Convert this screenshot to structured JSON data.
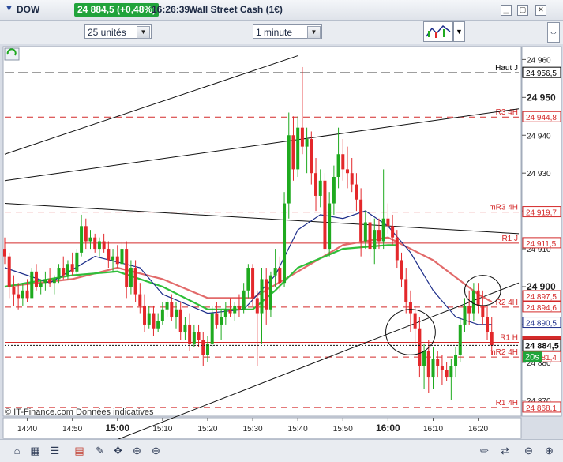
{
  "header": {
    "instrument": "DOW",
    "price_change": "24 884,5 (+0,48%)",
    "time": "16:26:39",
    "title": "Wall Street Cash (1€)",
    "dropdown_icon": "chevron-down-icon",
    "window_icons": [
      "minimize-icon",
      "maximize-icon",
      "close-icon"
    ]
  },
  "toolbar": {
    "units_select": "25 unités",
    "interval_select": "1 minute",
    "chart_tool_icon": "indicator-chart-icon"
  },
  "colors": {
    "bull": "#1faa1f",
    "bear": "#e3282b",
    "ma_slow": "#e26a6a",
    "ma_mid": "#2fbf3a",
    "ma_fast": "#1d2e8a",
    "price_tag": "#1fa53a"
  },
  "chart_data": {
    "type": "candlestick",
    "ylim": [
      24866,
      24963
    ],
    "yticks": [
      24870,
      24880,
      24890,
      24900,
      24910,
      24920,
      24930,
      24940,
      24950,
      24960
    ],
    "ytick_labels": [
      "24 870",
      "24 880",
      "24 890",
      "24 900",
      "24 910",
      "24 920",
      "24 930",
      "24 940",
      "24 950",
      "24 960"
    ],
    "major_yticks": [
      24950,
      24900
    ],
    "x_start": "14:35",
    "x_end": "16:29",
    "xticks": [
      "14:40",
      "14:50",
      "15:00",
      "15:10",
      "15:20",
      "15:30",
      "15:40",
      "15:50",
      "16:00",
      "16:10",
      "16:20"
    ],
    "major_xticks": [
      "15:00",
      "16:00"
    ],
    "levels": [
      {
        "name": "Haut J",
        "value": 24956.5,
        "label": "24 956,5",
        "style": "longdash",
        "color": "#000000"
      },
      {
        "name": "R3 4H",
        "value": 24944.8,
        "label": "24 944,8",
        "style": "dash",
        "color": "#d42a2a"
      },
      {
        "name": "mR3 4H",
        "value": 24919.7,
        "label": "24 919,7",
        "style": "dash",
        "color": "#d42a2a"
      },
      {
        "name": "R1 J",
        "value": 24911.5,
        "label": "24 911,5",
        "style": "solid",
        "color": "#d42a2a"
      },
      {
        "name": "",
        "value": 24897.5,
        "label": "24 897,5",
        "style": "none",
        "color": "#d42a2a"
      },
      {
        "name": "R2 4H",
        "value": 24894.6,
        "label": "24 894,6",
        "style": "dash",
        "color": "#d42a2a"
      },
      {
        "name": "",
        "value": 24890.5,
        "label": "24 890,5",
        "style": "none",
        "color": "#1d2e8a"
      },
      {
        "name": "R1 H",
        "value": 24885.3,
        "label": "24 885,3",
        "style": "solid",
        "color": "#d42a2a"
      },
      {
        "name": "mR2 4H",
        "value": 24881.4,
        "label": "24 881,4",
        "style": "dash",
        "color": "#d42a2a"
      },
      {
        "name": "R1 4H",
        "value": 24868.1,
        "label": "24 868,1",
        "style": "dash",
        "color": "#d42a2a"
      }
    ],
    "current_price": {
      "value": 24884.5,
      "label": "24 884,5",
      "countdown": "20s"
    },
    "candles": [
      {
        "t": "14:35",
        "o": 24910,
        "h": 24913,
        "l": 24906,
        "c": 24908
      },
      {
        "t": "14:36",
        "o": 24908,
        "h": 24909,
        "l": 24897,
        "c": 24900
      },
      {
        "t": "14:37",
        "o": 24900,
        "h": 24903,
        "l": 24895,
        "c": 24898
      },
      {
        "t": "14:38",
        "o": 24898,
        "h": 24901,
        "l": 24894,
        "c": 24897
      },
      {
        "t": "14:39",
        "o": 24897,
        "h": 24901,
        "l": 24895,
        "c": 24899
      },
      {
        "t": "14:40",
        "o": 24899,
        "h": 24902,
        "l": 24896,
        "c": 24897
      },
      {
        "t": "14:41",
        "o": 24897,
        "h": 24905,
        "l": 24897,
        "c": 24904
      },
      {
        "t": "14:42",
        "o": 24904,
        "h": 24906,
        "l": 24899,
        "c": 24900
      },
      {
        "t": "14:43",
        "o": 24900,
        "h": 24902,
        "l": 24898,
        "c": 24901
      },
      {
        "t": "14:44",
        "o": 24901,
        "h": 24904,
        "l": 24899,
        "c": 24902
      },
      {
        "t": "14:45",
        "o": 24902,
        "h": 24905,
        "l": 24900,
        "c": 24901
      },
      {
        "t": "14:46",
        "o": 24901,
        "h": 24903,
        "l": 24898,
        "c": 24902
      },
      {
        "t": "14:47",
        "o": 24902,
        "h": 24906,
        "l": 24901,
        "c": 24905
      },
      {
        "t": "14:48",
        "o": 24905,
        "h": 24908,
        "l": 24902,
        "c": 24903
      },
      {
        "t": "14:49",
        "o": 24903,
        "h": 24907,
        "l": 24902,
        "c": 24906
      },
      {
        "t": "14:50",
        "o": 24906,
        "h": 24909,
        "l": 24903,
        "c": 24904
      },
      {
        "t": "14:51",
        "o": 24904,
        "h": 24910,
        "l": 24903,
        "c": 24909
      },
      {
        "t": "14:52",
        "o": 24909,
        "h": 24919,
        "l": 24908,
        "c": 24916
      },
      {
        "t": "14:53",
        "o": 24916,
        "h": 24918,
        "l": 24910,
        "c": 24912
      },
      {
        "t": "14:54",
        "o": 24912,
        "h": 24915,
        "l": 24910,
        "c": 24913
      },
      {
        "t": "14:55",
        "o": 24913,
        "h": 24914,
        "l": 24909,
        "c": 24910
      },
      {
        "t": "14:56",
        "o": 24910,
        "h": 24913,
        "l": 24908,
        "c": 24912
      },
      {
        "t": "14:57",
        "o": 24912,
        "h": 24914,
        "l": 24909,
        "c": 24910
      },
      {
        "t": "14:58",
        "o": 24910,
        "h": 24912,
        "l": 24905,
        "c": 24907
      },
      {
        "t": "14:59",
        "o": 24907,
        "h": 24910,
        "l": 24904,
        "c": 24908
      },
      {
        "t": "15:00",
        "o": 24908,
        "h": 24911,
        "l": 24905,
        "c": 24906
      },
      {
        "t": "15:01",
        "o": 24906,
        "h": 24912,
        "l": 24904,
        "c": 24910
      },
      {
        "t": "15:02",
        "o": 24910,
        "h": 24912,
        "l": 24897,
        "c": 24900
      },
      {
        "t": "15:03",
        "o": 24900,
        "h": 24907,
        "l": 24898,
        "c": 24905
      },
      {
        "t": "15:04",
        "o": 24905,
        "h": 24907,
        "l": 24896,
        "c": 24898
      },
      {
        "t": "15:05",
        "o": 24898,
        "h": 24901,
        "l": 24893,
        "c": 24895
      },
      {
        "t": "15:06",
        "o": 24895,
        "h": 24898,
        "l": 24888,
        "c": 24890
      },
      {
        "t": "15:07",
        "o": 24890,
        "h": 24895,
        "l": 24889,
        "c": 24893
      },
      {
        "t": "15:08",
        "o": 24893,
        "h": 24895,
        "l": 24887,
        "c": 24889
      },
      {
        "t": "15:09",
        "o": 24889,
        "h": 24893,
        "l": 24888,
        "c": 24891
      },
      {
        "t": "15:10",
        "o": 24891,
        "h": 24896,
        "l": 24890,
        "c": 24894
      },
      {
        "t": "15:11",
        "o": 24894,
        "h": 24897,
        "l": 24892,
        "c": 24896
      },
      {
        "t": "15:12",
        "o": 24896,
        "h": 24898,
        "l": 24891,
        "c": 24892
      },
      {
        "t": "15:13",
        "o": 24892,
        "h": 24896,
        "l": 24889,
        "c": 24894
      },
      {
        "t": "15:14",
        "o": 24894,
        "h": 24896,
        "l": 24886,
        "c": 24888
      },
      {
        "t": "15:15",
        "o": 24888,
        "h": 24892,
        "l": 24886,
        "c": 24890
      },
      {
        "t": "15:16",
        "o": 24890,
        "h": 24893,
        "l": 24883,
        "c": 24885
      },
      {
        "t": "15:17",
        "o": 24885,
        "h": 24890,
        "l": 24884,
        "c": 24888
      },
      {
        "t": "15:18",
        "o": 24888,
        "h": 24890,
        "l": 24884,
        "c": 24886
      },
      {
        "t": "15:19",
        "o": 24886,
        "h": 24888,
        "l": 24879,
        "c": 24882
      },
      {
        "t": "15:20",
        "o": 24882,
        "h": 24887,
        "l": 24880,
        "c": 24885
      },
      {
        "t": "15:21",
        "o": 24885,
        "h": 24895,
        "l": 24884,
        "c": 24893
      },
      {
        "t": "15:22",
        "o": 24893,
        "h": 24896,
        "l": 24889,
        "c": 24890
      },
      {
        "t": "15:23",
        "o": 24890,
        "h": 24894,
        "l": 24886,
        "c": 24892
      },
      {
        "t": "15:24",
        "o": 24892,
        "h": 24896,
        "l": 24890,
        "c": 24894
      },
      {
        "t": "15:25",
        "o": 24894,
        "h": 24897,
        "l": 24892,
        "c": 24893
      },
      {
        "t": "15:26",
        "o": 24893,
        "h": 24896,
        "l": 24891,
        "c": 24895
      },
      {
        "t": "15:27",
        "o": 24895,
        "h": 24898,
        "l": 24892,
        "c": 24894
      },
      {
        "t": "15:28",
        "o": 24894,
        "h": 24901,
        "l": 24893,
        "c": 24899
      },
      {
        "t": "15:29",
        "o": 24899,
        "h": 24906,
        "l": 24897,
        "c": 24905
      },
      {
        "t": "15:30",
        "o": 24905,
        "h": 24906,
        "l": 24895,
        "c": 24897
      },
      {
        "t": "15:31",
        "o": 24897,
        "h": 24899,
        "l": 24879,
        "c": 24893
      },
      {
        "t": "15:32",
        "o": 24893,
        "h": 24905,
        "l": 24885,
        "c": 24902
      },
      {
        "t": "15:33",
        "o": 24902,
        "h": 24905,
        "l": 24890,
        "c": 24894
      },
      {
        "t": "15:34",
        "o": 24894,
        "h": 24904,
        "l": 24892,
        "c": 24903
      },
      {
        "t": "15:35",
        "o": 24903,
        "h": 24910,
        "l": 24900,
        "c": 24905
      },
      {
        "t": "15:36",
        "o": 24905,
        "h": 24908,
        "l": 24899,
        "c": 24901
      },
      {
        "t": "15:37",
        "o": 24901,
        "h": 24925,
        "l": 24900,
        "c": 24922
      },
      {
        "t": "15:38",
        "o": 24922,
        "h": 24946,
        "l": 24918,
        "c": 24940
      },
      {
        "t": "15:39",
        "o": 24940,
        "h": 24945,
        "l": 24928,
        "c": 24931
      },
      {
        "t": "15:40",
        "o": 24931,
        "h": 24945,
        "l": 24929,
        "c": 24942
      },
      {
        "t": "15:41",
        "o": 24942,
        "h": 24958,
        "l": 24935,
        "c": 24937
      },
      {
        "t": "15:42",
        "o": 24937,
        "h": 24942,
        "l": 24930,
        "c": 24939
      },
      {
        "t": "15:43",
        "o": 24939,
        "h": 24941,
        "l": 24927,
        "c": 24930
      },
      {
        "t": "15:44",
        "o": 24930,
        "h": 24934,
        "l": 24920,
        "c": 24924
      },
      {
        "t": "15:45",
        "o": 24924,
        "h": 24931,
        "l": 24921,
        "c": 24928
      },
      {
        "t": "15:46",
        "o": 24928,
        "h": 24930,
        "l": 24908,
        "c": 24910
      },
      {
        "t": "15:47",
        "o": 24910,
        "h": 24925,
        "l": 24908,
        "c": 24922
      },
      {
        "t": "15:48",
        "o": 24922,
        "h": 24932,
        "l": 24919,
        "c": 24929
      },
      {
        "t": "15:49",
        "o": 24929,
        "h": 24942,
        "l": 24926,
        "c": 24935
      },
      {
        "t": "15:50",
        "o": 24935,
        "h": 24939,
        "l": 24928,
        "c": 24931
      },
      {
        "t": "15:51",
        "o": 24931,
        "h": 24937,
        "l": 24926,
        "c": 24930
      },
      {
        "t": "15:52",
        "o": 24930,
        "h": 24934,
        "l": 24925,
        "c": 24927
      },
      {
        "t": "15:53",
        "o": 24927,
        "h": 24930,
        "l": 24920,
        "c": 24923
      },
      {
        "t": "15:54",
        "o": 24923,
        "h": 24926,
        "l": 24908,
        "c": 24912
      },
      {
        "t": "15:55",
        "o": 24912,
        "h": 24920,
        "l": 24910,
        "c": 24917
      },
      {
        "t": "15:56",
        "o": 24917,
        "h": 24919,
        "l": 24908,
        "c": 24910
      },
      {
        "t": "15:57",
        "o": 24910,
        "h": 24918,
        "l": 24906,
        "c": 24915
      },
      {
        "t": "15:58",
        "o": 24915,
        "h": 24918,
        "l": 24910,
        "c": 24912
      },
      {
        "t": "15:59",
        "o": 24912,
        "h": 24931,
        "l": 24910,
        "c": 24918
      },
      {
        "t": "16:00",
        "o": 24918,
        "h": 24922,
        "l": 24914,
        "c": 24916
      },
      {
        "t": "16:01",
        "o": 24916,
        "h": 24919,
        "l": 24911,
        "c": 24913
      },
      {
        "t": "16:02",
        "o": 24913,
        "h": 24915,
        "l": 24905,
        "c": 24907
      },
      {
        "t": "16:03",
        "o": 24907,
        "h": 24909,
        "l": 24900,
        "c": 24902
      },
      {
        "t": "16:04",
        "o": 24902,
        "h": 24905,
        "l": 24893,
        "c": 24896
      },
      {
        "t": "16:05",
        "o": 24896,
        "h": 24899,
        "l": 24888,
        "c": 24893
      },
      {
        "t": "16:06",
        "o": 24893,
        "h": 24895,
        "l": 24885,
        "c": 24889
      },
      {
        "t": "16:07",
        "o": 24889,
        "h": 24892,
        "l": 24876,
        "c": 24879
      },
      {
        "t": "16:08",
        "o": 24879,
        "h": 24885,
        "l": 24873,
        "c": 24883
      },
      {
        "t": "16:09",
        "o": 24883,
        "h": 24886,
        "l": 24872,
        "c": 24876
      },
      {
        "t": "16:10",
        "o": 24876,
        "h": 24884,
        "l": 24873,
        "c": 24881
      },
      {
        "t": "16:11",
        "o": 24881,
        "h": 24883,
        "l": 24876,
        "c": 24879
      },
      {
        "t": "16:12",
        "o": 24879,
        "h": 24882,
        "l": 24874,
        "c": 24878
      },
      {
        "t": "16:13",
        "o": 24878,
        "h": 24880,
        "l": 24875,
        "c": 24876
      },
      {
        "t": "16:14",
        "o": 24876,
        "h": 24881,
        "l": 24870,
        "c": 24879
      },
      {
        "t": "16:15",
        "o": 24879,
        "h": 24884,
        "l": 24876,
        "c": 24882
      },
      {
        "t": "16:16",
        "o": 24882,
        "h": 24892,
        "l": 24880,
        "c": 24890
      },
      {
        "t": "16:17",
        "o": 24890,
        "h": 24897,
        "l": 24888,
        "c": 24895
      },
      {
        "t": "16:18",
        "o": 24895,
        "h": 24899,
        "l": 24890,
        "c": 24893
      },
      {
        "t": "16:19",
        "o": 24893,
        "h": 24901,
        "l": 24891,
        "c": 24899
      },
      {
        "t": "16:20",
        "o": 24899,
        "h": 24901,
        "l": 24893,
        "c": 24895
      },
      {
        "t": "16:21",
        "o": 24895,
        "h": 24899,
        "l": 24890,
        "c": 24892
      },
      {
        "t": "16:22",
        "o": 24892,
        "h": 24895,
        "l": 24886,
        "c": 24888
      },
      {
        "t": "16:23",
        "o": 24888,
        "h": 24892,
        "l": 24882,
        "c": 24884.5
      }
    ],
    "moving_averages": [
      {
        "key": "ma_slow",
        "points": [
          [
            "14:35",
            24900
          ],
          [
            "14:50",
            24902
          ],
          [
            "15:00",
            24905
          ],
          [
            "15:10",
            24902
          ],
          [
            "15:20",
            24897
          ],
          [
            "15:30",
            24897
          ],
          [
            "15:40",
            24904
          ],
          [
            "15:50",
            24911
          ],
          [
            "16:00",
            24913
          ],
          [
            "16:10",
            24907
          ],
          [
            "16:20",
            24898
          ],
          [
            "16:23",
            24896
          ]
        ]
      },
      {
        "key": "ma_mid",
        "points": [
          [
            "14:35",
            24900
          ],
          [
            "14:50",
            24903
          ],
          [
            "15:00",
            24904
          ],
          [
            "15:10",
            24900
          ],
          [
            "15:20",
            24894
          ],
          [
            "15:30",
            24894
          ],
          [
            "15:35",
            24899
          ],
          [
            "15:40",
            24905
          ],
          [
            "15:50",
            24910
          ],
          [
            "16:00",
            24911
          ],
          [
            "16:02",
            24911
          ]
        ]
      },
      {
        "key": "ma_fast",
        "points": [
          [
            "14:35",
            24905
          ],
          [
            "14:45",
            24901
          ],
          [
            "14:55",
            24908
          ],
          [
            "15:05",
            24905
          ],
          [
            "15:10",
            24898
          ],
          [
            "15:20",
            24893
          ],
          [
            "15:28",
            24894
          ],
          [
            "15:35",
            24903
          ],
          [
            "15:40",
            24915
          ],
          [
            "15:45",
            24919
          ],
          [
            "15:50",
            24918
          ],
          [
            "15:55",
            24920
          ],
          [
            "16:00",
            24916
          ],
          [
            "16:05",
            24909
          ],
          [
            "16:10",
            24899
          ],
          [
            "16:15",
            24892
          ],
          [
            "16:20",
            24890
          ],
          [
            "16:23",
            24890
          ]
        ]
      }
    ],
    "trendlines": [
      {
        "from": [
          "14:35",
          24935
        ],
        "to": [
          "15:40",
          24961
        ]
      },
      {
        "from": [
          "14:35",
          24928
        ],
        "to": [
          "16:29",
          24947
        ]
      },
      {
        "from": [
          "14:35",
          24922
        ],
        "to": [
          "16:29",
          24914
        ]
      },
      {
        "from": [
          "14:35",
          24848
        ],
        "to": [
          "16:29",
          24901
        ]
      }
    ],
    "ellipses": [
      {
        "center": [
          "16:05",
          24888
        ],
        "rx_minutes": 5.5,
        "ry_value": 6
      },
      {
        "center": [
          "16:21",
          24899
        ],
        "rx_minutes": 4,
        "ry_value": 4
      }
    ],
    "watermark": "© IT-Finance.com  Données indicatives"
  },
  "bottombar": {
    "icons": [
      "home-icon",
      "calculator-icon",
      "list-icon",
      "calendar-icon",
      "pen-icon",
      "move-icon",
      "zoom-in-icon",
      "zoom-out-icon",
      "pen-tool-icon",
      "arrows-icon",
      "zoom-minus-icon",
      "zoom-plus-icon"
    ]
  }
}
